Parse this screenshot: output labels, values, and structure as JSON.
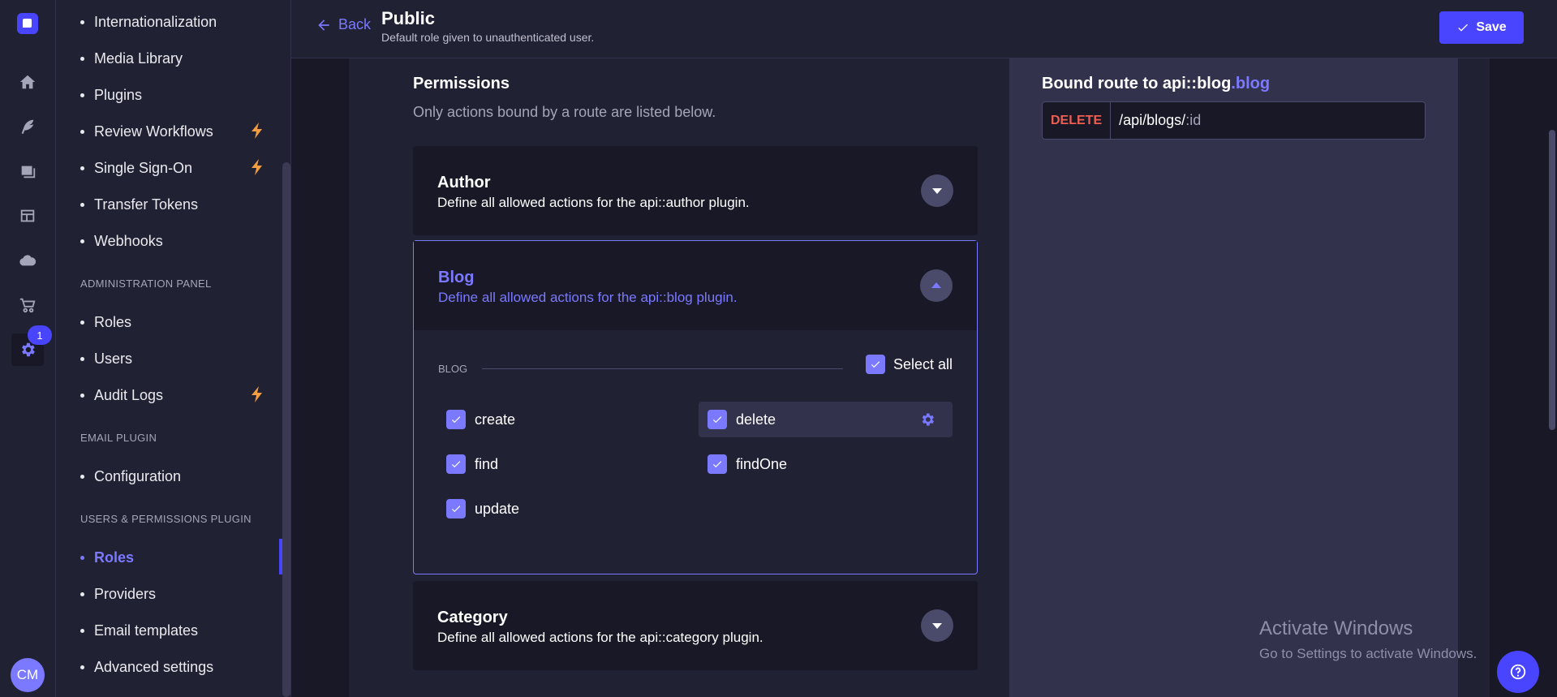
{
  "rail": {
    "notification_count": "1",
    "user_initials": "CM",
    "icons": [
      "logo-icon",
      "home-icon",
      "content-manager-icon",
      "media-library-icon",
      "content-type-builder-icon",
      "cloud-icon",
      "marketplace-icon",
      "settings-icon"
    ]
  },
  "subnav": {
    "items_top": [
      {
        "label": "Internationalization"
      },
      {
        "label": "Media Library"
      },
      {
        "label": "Plugins"
      },
      {
        "label": "Review Workflows"
      },
      {
        "label": "Single Sign-On"
      },
      {
        "label": "Transfer Tokens"
      },
      {
        "label": "Webhooks"
      }
    ],
    "admin_label": "ADMINISTRATION PANEL",
    "admin_items": [
      {
        "label": "Roles"
      },
      {
        "label": "Users"
      },
      {
        "label": "Audit Logs"
      }
    ],
    "email_label": "EMAIL PLUGIN",
    "email_items": [
      {
        "label": "Configuration"
      }
    ],
    "users_label": "USERS & PERMISSIONS PLUGIN",
    "users_items": [
      {
        "label": "Roles"
      },
      {
        "label": "Providers"
      },
      {
        "label": "Email templates"
      },
      {
        "label": "Advanced settings"
      }
    ]
  },
  "header": {
    "back_label": "Back",
    "title": "Public",
    "subtitle": "Default role given to unauthenticated user.",
    "save_label": "Save"
  },
  "permissions": {
    "title": "Permissions",
    "subtitle": "Only actions bound by a route are listed below.",
    "author": {
      "title": "Author",
      "description": "Define all allowed actions for the api::author plugin."
    },
    "blog": {
      "title": "Blog",
      "description": "Define all allowed actions for the api::blog plugin.",
      "group_label": "BLOG",
      "select_all_label": "Select all",
      "actions": [
        {
          "label": "create",
          "checked": true
        },
        {
          "label": "delete",
          "checked": true
        },
        {
          "label": "find",
          "checked": true
        },
        {
          "label": "findOne",
          "checked": true
        },
        {
          "label": "update",
          "checked": true
        }
      ]
    },
    "category": {
      "title": "Category",
      "description": "Define all allowed actions for the api::category plugin."
    }
  },
  "route": {
    "title_prefix": "Bound route to ",
    "title_api": "api::blog",
    "title_accent": ".blog",
    "method": "DELETE",
    "path": "/api/blogs/",
    "param": ":id"
  },
  "watermark": {
    "title": "Activate Windows",
    "subtitle": "Go to Settings to activate Windows."
  },
  "colors": {
    "accent": "#7b79ff",
    "primary": "#4945ff",
    "danger": "#ee5e52",
    "warning": "#f29d41"
  }
}
